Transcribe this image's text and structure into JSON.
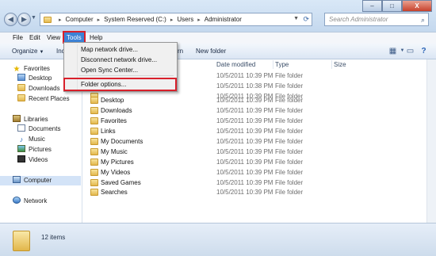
{
  "window": {
    "controls": [
      "–",
      "□",
      "X"
    ]
  },
  "address": {
    "segments": [
      "Computer",
      "System Reserved (C:)",
      "Users",
      "Administrator"
    ]
  },
  "search": {
    "placeholder": "Search Administrator"
  },
  "menubar": {
    "items": [
      "File",
      "Edit",
      "View",
      "Tools",
      "Help"
    ],
    "active": "Tools"
  },
  "toolbar": {
    "organize": "Organize",
    "include_partial": "Inc",
    "burn_partial": "rn",
    "new_folder": "New folder"
  },
  "tools_menu": {
    "items": [
      "Map network drive...",
      "Disconnect network drive...",
      "Open Sync Center...",
      "Folder options..."
    ]
  },
  "columns": {
    "date": "Date modified",
    "type": "Type",
    "size": "Size"
  },
  "files": [
    {
      "name": "",
      "date": "10/5/2011 10:39 PM",
      "type": "File folder"
    },
    {
      "name": "",
      "date": "10/5/2011 10:38 PM",
      "type": "File folder"
    },
    {
      "name": "",
      "date": "10/5/2011 10:39 PM",
      "type": "File folder"
    },
    {
      "name": "Desktop",
      "date": "10/5/2011 10:39 PM",
      "type": "File folder"
    },
    {
      "name": "Downloads",
      "date": "10/5/2011 10:39 PM",
      "type": "File folder"
    },
    {
      "name": "Favorites",
      "date": "10/5/2011 10:39 PM",
      "type": "File folder"
    },
    {
      "name": "Links",
      "date": "10/5/2011 10:39 PM",
      "type": "File folder"
    },
    {
      "name": "My Documents",
      "date": "10/5/2011 10:39 PM",
      "type": "File folder"
    },
    {
      "name": "My Music",
      "date": "10/5/2011 10:39 PM",
      "type": "File folder"
    },
    {
      "name": "My Pictures",
      "date": "10/5/2011 10:39 PM",
      "type": "File folder"
    },
    {
      "name": "My Videos",
      "date": "10/5/2011 10:39 PM",
      "type": "File folder"
    },
    {
      "name": "Saved Games",
      "date": "10/5/2011 10:39 PM",
      "type": "File folder"
    },
    {
      "name": "Searches",
      "date": "10/5/2011 10:39 PM",
      "type": "File folder"
    }
  ],
  "nav": {
    "favorites": "Favorites",
    "desktop": "Desktop",
    "downloads": "Downloads",
    "recent": "Recent Places",
    "libraries": "Libraries",
    "documents": "Documents",
    "music": "Music",
    "pictures": "Pictures",
    "videos": "Videos",
    "computer": "Computer",
    "network": "Network"
  },
  "status": {
    "count": "12 items"
  }
}
